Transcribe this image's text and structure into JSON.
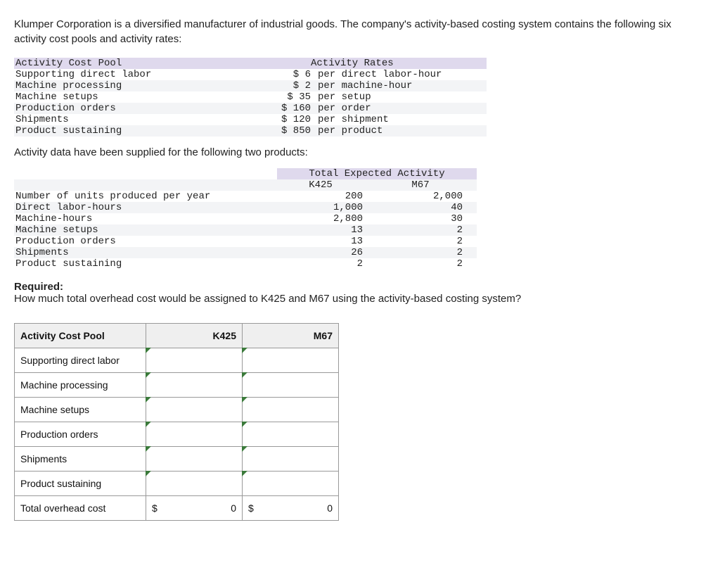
{
  "intro": "Klumper Corporation is a diversified manufacturer of industrial goods. The company's activity-based costing system contains the following six activity cost pools and activity rates:",
  "rates_header": {
    "col1": "Activity Cost Pool",
    "col2": "Activity Rates"
  },
  "rates": [
    {
      "label": "Supporting direct labor",
      "amount": "$ 6",
      "unit": "per direct labor-hour"
    },
    {
      "label": "Machine processing",
      "amount": "$ 2",
      "unit": "per machine-hour"
    },
    {
      "label": "Machine setups",
      "amount": "$ 35",
      "unit": "per setup"
    },
    {
      "label": "Production orders",
      "amount": "$ 160",
      "unit": "per order"
    },
    {
      "label": "Shipments",
      "amount": "$ 120",
      "unit": "per shipment"
    },
    {
      "label": "Product sustaining",
      "amount": "$ 850",
      "unit": "per product"
    }
  ],
  "activity_intro": "Activity data have been supplied for the following two products:",
  "activity_header": {
    "span": "Total Expected Activity",
    "c1": "K425",
    "c2": "M67"
  },
  "activity_rows": [
    {
      "label": "Number of units produced per year",
      "k425": "200",
      "m67": "2,000"
    },
    {
      "label": "Direct labor-hours",
      "k425": "1,000",
      "m67": "40"
    },
    {
      "label": "Machine-hours",
      "k425": "2,800",
      "m67": "30"
    },
    {
      "label": "Machine setups",
      "k425": "13",
      "m67": "2"
    },
    {
      "label": "Production orders",
      "k425": "13",
      "m67": "2"
    },
    {
      "label": "Shipments",
      "k425": "26",
      "m67": "2"
    },
    {
      "label": "Product sustaining",
      "k425": "2",
      "m67": "2"
    }
  ],
  "required_head": "Required:",
  "required_text": "How much total overhead cost would be assigned to K425 and M67 using the activity-based costing system?",
  "answer_header": {
    "pool": "Activity Cost Pool",
    "k425": "K425",
    "m67": "M67"
  },
  "answer_rows": [
    "Supporting direct labor",
    "Machine processing",
    "Machine setups",
    "Production orders",
    "Shipments",
    "Product sustaining"
  ],
  "answer_total": {
    "label": "Total overhead cost",
    "k425_prefix": "$",
    "k425_value": "0",
    "m67_prefix": "$",
    "m67_value": "0"
  },
  "chart_data": {
    "type": "table",
    "activity_rates": {
      "Supporting direct labor": {
        "rate": 6,
        "unit": "direct labor-hour"
      },
      "Machine processing": {
        "rate": 2,
        "unit": "machine-hour"
      },
      "Machine setups": {
        "rate": 35,
        "unit": "setup"
      },
      "Production orders": {
        "rate": 160,
        "unit": "order"
      },
      "Shipments": {
        "rate": 120,
        "unit": "shipment"
      },
      "Product sustaining": {
        "rate": 850,
        "unit": "product"
      }
    },
    "expected_activity": {
      "K425": {
        "units_produced": 200,
        "direct_labor_hours": 1000,
        "machine_hours": 2800,
        "machine_setups": 13,
        "production_orders": 13,
        "shipments": 26,
        "product_sustaining": 2
      },
      "M67": {
        "units_produced": 2000,
        "direct_labor_hours": 40,
        "machine_hours": 30,
        "machine_setups": 2,
        "production_orders": 2,
        "shipments": 2,
        "product_sustaining": 2
      }
    },
    "answer_totals_displayed": {
      "K425": 0,
      "M67": 0
    }
  }
}
